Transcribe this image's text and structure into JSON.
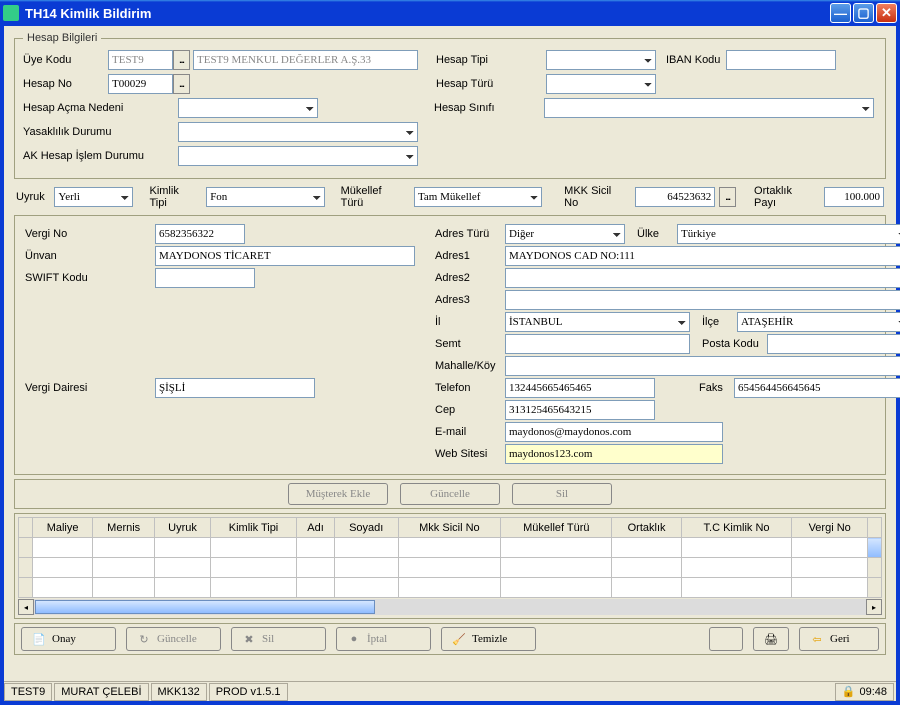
{
  "window": {
    "title": "TH14 Kimlik Bildirim"
  },
  "hesap": {
    "legend": "Hesap Bilgileri",
    "uye_kodu_lbl": "Üye Kodu",
    "uye_kodu": "TEST9",
    "uye_adi": "TEST9 MENKUL DEĞERLER A.Ş.33",
    "hesap_tipi_lbl": "Hesap Tipi",
    "iban_kodu_lbl": "IBAN Kodu",
    "hesap_no_lbl": "Hesap No",
    "hesap_no": "T00029",
    "hesap_turu_lbl": "Hesap Türü",
    "hesap_acma_lbl": "Hesap Açma Nedeni",
    "hesap_sinifi_lbl": "Hesap Sınıfı",
    "yasaklilik_lbl": "Yasaklılık Durumu",
    "ak_islem_lbl": "AK Hesap İşlem Durumu"
  },
  "mid": {
    "uyruk_lbl": "Uyruk",
    "uyruk": "Yerli",
    "kimlik_tipi_lbl": "Kimlik Tipi",
    "kimlik_tipi": "Fon",
    "mukellef_turu_lbl": "Mükellef Türü",
    "mukellef_turu": "Tam Mükellef",
    "mkk_sicil_lbl": "MKK Sicil No",
    "mkk_sicil": "64523632",
    "ortaklik_payi_lbl": "Ortaklık Payı",
    "ortaklik_payi": "100.000"
  },
  "det": {
    "vergi_no_lbl": "Vergi No",
    "vergi_no": "6582356322",
    "unvan_lbl": "Ünvan",
    "unvan": "MAYDONOS TİCARET",
    "swift_lbl": "SWIFT Kodu",
    "swift": "",
    "vergi_dairesi_lbl": "Vergi Dairesi",
    "vergi_dairesi": "ŞİŞLİ",
    "adres_turu_lbl": "Adres Türü",
    "adres_turu": "Diğer",
    "ulke_lbl": "Ülke",
    "ulke": "Türkiye",
    "adres1_lbl": "Adres1",
    "adres1": "MAYDONOS CAD NO:111",
    "adres2_lbl": "Adres2",
    "adres2": "",
    "adres3_lbl": "Adres3",
    "adres3": "",
    "il_lbl": "İl",
    "il": "İSTANBUL",
    "ilce_lbl": "İlçe",
    "ilce": "ATAŞEHİR",
    "semt_lbl": "Semt",
    "semt": "",
    "posta_lbl": "Posta Kodu",
    "posta": "",
    "mahalle_lbl": "Mahalle/Köy",
    "mahalle": "",
    "telefon_lbl": "Telefon",
    "telefon": "132445665465465",
    "faks_lbl": "Faks",
    "faks": "654564456645645",
    "cep_lbl": "Cep",
    "cep": "313125465643215",
    "email_lbl": "E-mail",
    "email": "maydonos@maydonos.com",
    "web_lbl": "Web Sitesi",
    "web": "maydonos123.com"
  },
  "btns": {
    "musterek": "Müşterek Ekle",
    "guncelle": "Güncelle",
    "sil": "Sil"
  },
  "grid": {
    "cols": [
      "Maliye",
      "Mernis",
      "Uyruk",
      "Kimlik Tipi",
      "Adı",
      "Soyadı",
      "Mkk Sicil No",
      "Mükellef Türü",
      "Ortaklık",
      "T.C Kimlik No",
      "Vergi No"
    ]
  },
  "actions": {
    "onay": "Onay",
    "guncelle": "Güncelle",
    "sil": "Sil",
    "iptal": "İptal",
    "temizle": "Temizle",
    "geri": "Geri"
  },
  "status": {
    "s1": "TEST9",
    "s2": "MURAT ÇELEBİ",
    "s3": "MKK132",
    "s4": "PROD v1.5.1",
    "time": "09:48"
  }
}
